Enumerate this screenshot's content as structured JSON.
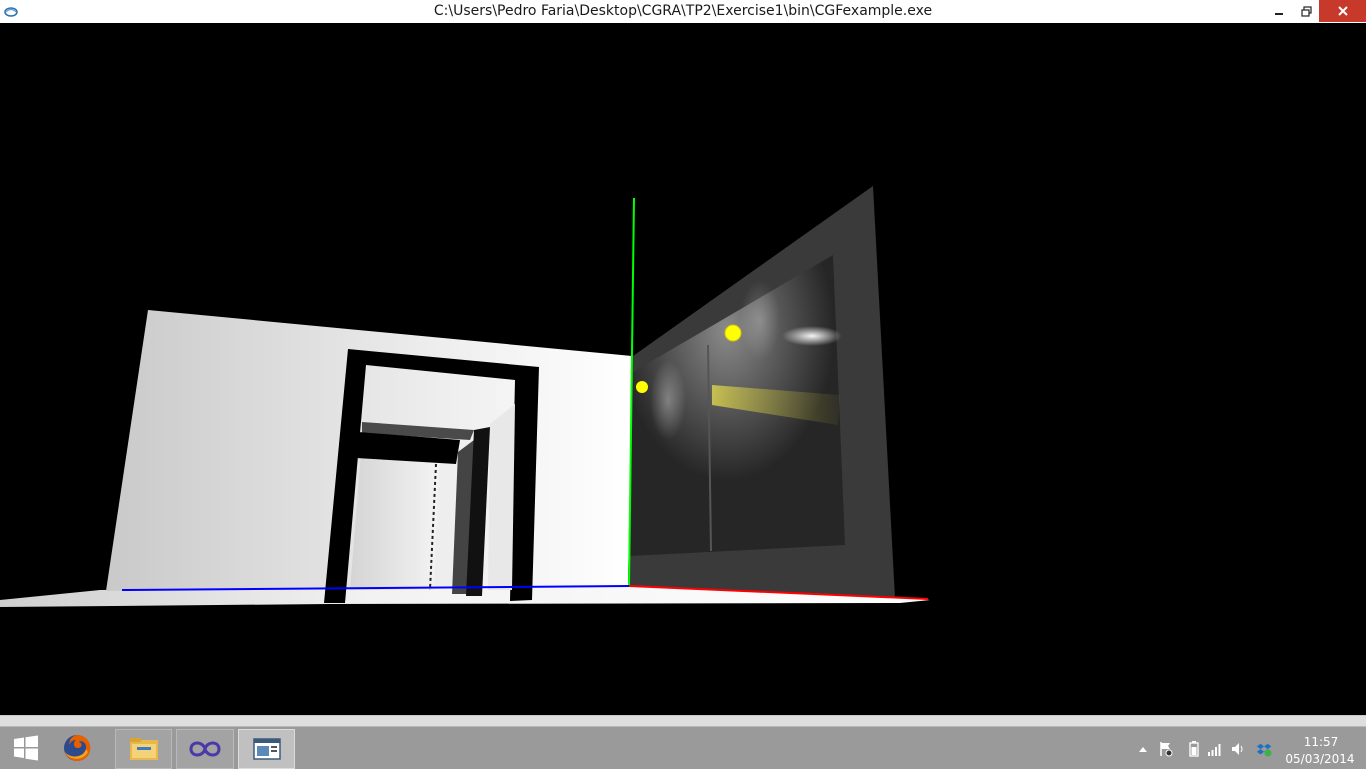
{
  "window": {
    "title": "C:\\Users\\Pedro Faria\\Desktop\\CGRA\\TP2\\Exercise1\\bin\\CGFexample.exe",
    "icon": "glut-app-icon",
    "controls": [
      "minimize-icon",
      "restore-icon",
      "close-icon"
    ]
  },
  "scene": {
    "description_colors": {
      "floor": "#ececec",
      "back_wall": "#f0f0f0",
      "right_wall": "#3a3a3a",
      "window_glass": "#2a2a2a",
      "light_marker": "#ffff00",
      "axis_x": "#ff0000",
      "axis_y": "#00ff00",
      "axis_z": "#0000ff"
    }
  },
  "taskbar": {
    "start_icon": "windows-logo-icon",
    "apps": [
      {
        "name": "firefox",
        "icon": "firefox-icon",
        "active": false
      },
      {
        "name": "file-explorer",
        "icon": "folder-icon",
        "active": false
      },
      {
        "name": "visual-studio",
        "icon": "visual-studio-icon",
        "active": false
      },
      {
        "name": "cgfexample",
        "icon": "app-window-icon",
        "active": true
      }
    ],
    "tray_icons": [
      "show-hidden-icons-chevron",
      "action-center-flag-icon",
      "battery-icon",
      "signal-icon",
      "volume-icon",
      "dropbox-icon"
    ],
    "clock": {
      "time": "11:57",
      "date": "05/03/2014"
    }
  }
}
